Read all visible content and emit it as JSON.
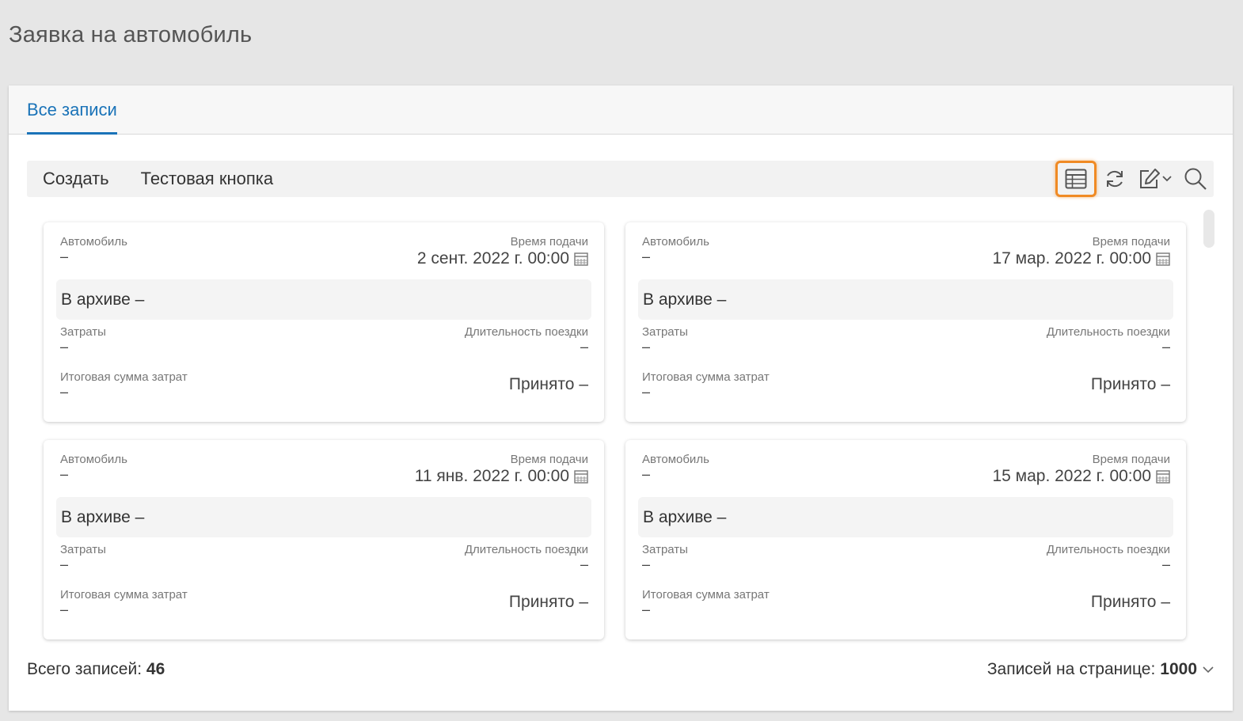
{
  "page": {
    "title": "Заявка на автомобиль"
  },
  "tabs": [
    {
      "label": "Все записи",
      "active": true
    }
  ],
  "toolbar": {
    "buttons": [
      {
        "label": "Создать"
      },
      {
        "label": "Тестовая кнопка"
      }
    ],
    "icons": [
      "table-view-icon",
      "refresh-icon",
      "edit-icon",
      "chevron-down-icon",
      "search-icon"
    ]
  },
  "labels": {
    "car": "Автомобиль",
    "time": "Время подачи",
    "archive": "В архиве",
    "costs": "Затраты",
    "duration": "Длительность поездки",
    "total": "Итоговая сумма затрат",
    "accepted": "Принято",
    "empty": "–"
  },
  "cards": [
    {
      "date": "2 сент. 2022 г. 00:00"
    },
    {
      "date": "17 мар. 2022 г. 00:00"
    },
    {
      "date": "11 янв. 2022 г. 00:00"
    },
    {
      "date": "15 мар. 2022 г. 00:00"
    }
  ],
  "footer": {
    "total_label": "Всего записей:",
    "total_value": "46",
    "per_page_label": "Записей на странице:",
    "per_page_value": "1000"
  },
  "colors": {
    "accent": "#1a73b8",
    "highlight": "#f08a24",
    "background": "#e6e6e6"
  }
}
